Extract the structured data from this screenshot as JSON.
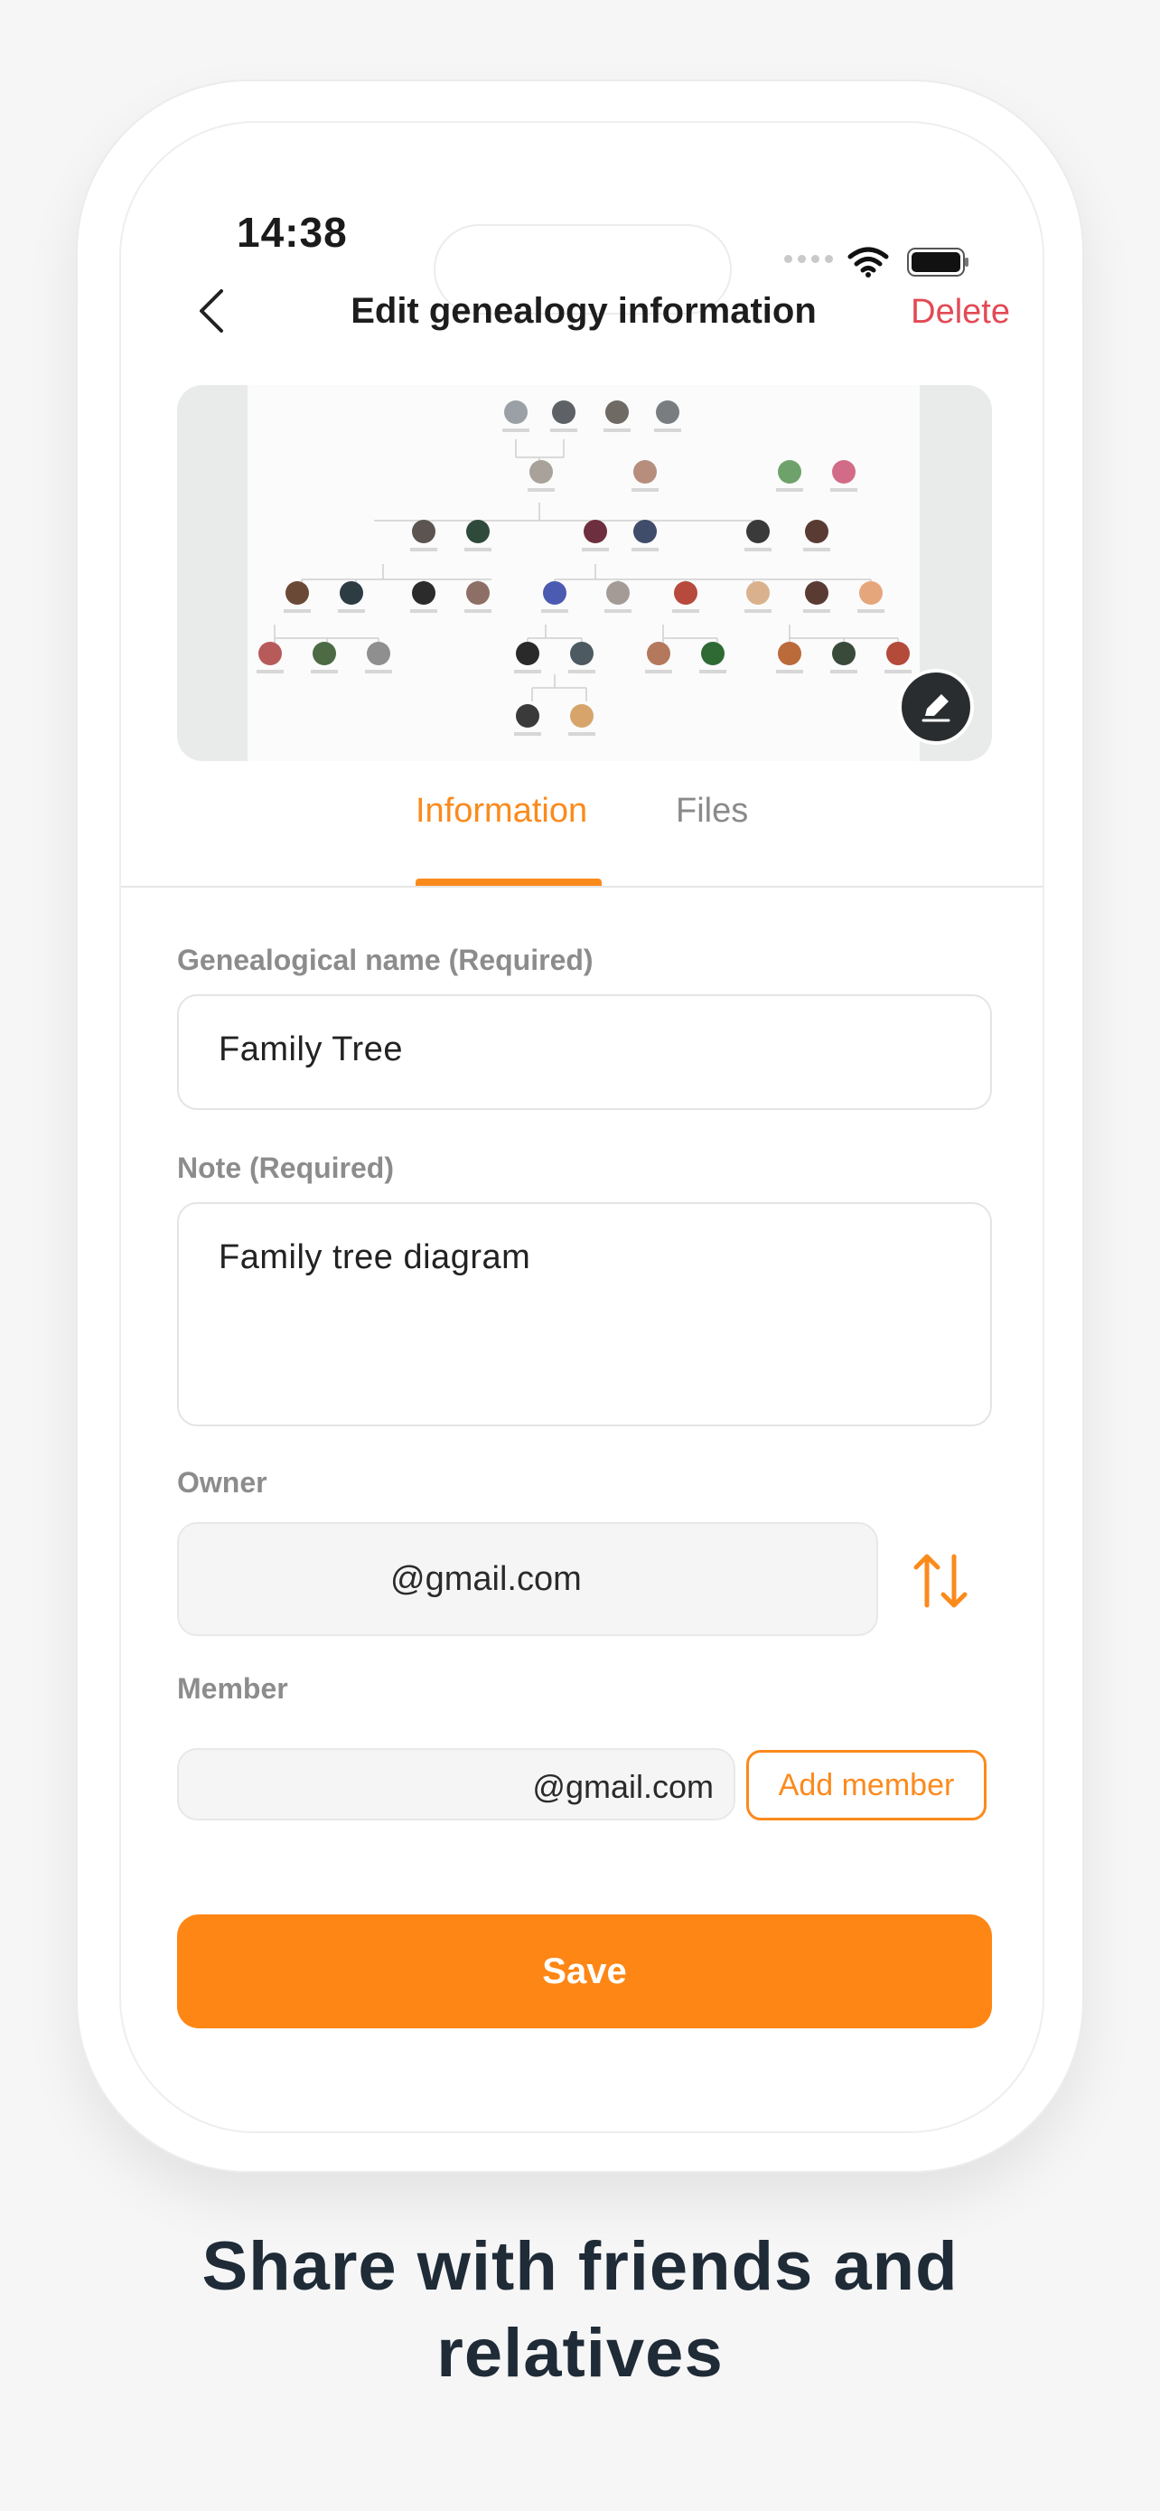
{
  "status": {
    "time": "14:38"
  },
  "nav": {
    "title": "Edit genealogy information",
    "delete_label": "Delete"
  },
  "tabs": [
    {
      "label": "Information"
    },
    {
      "label": "Files"
    }
  ],
  "form": {
    "name_label": "Genealogical name (Required)",
    "name_value": "Family Tree",
    "note_label": "Note (Required)",
    "note_value": "Family tree diagram",
    "owner_label": "Owner",
    "owner_value": "@gmail.com",
    "member_label": "Member",
    "member_value": "@gmail.com",
    "add_member_label": "Add member",
    "save_label": "Save"
  },
  "caption": {
    "line1": "Share with friends and",
    "line2": "relatives"
  },
  "colors": {
    "accent": "#fd8615",
    "delete": "#e24a55",
    "text": "#1d1d1d"
  },
  "icons": [
    "back-chevron-icon",
    "wifi-icon",
    "battery-icon",
    "pencil-icon",
    "swap-arrows-icon"
  ]
}
